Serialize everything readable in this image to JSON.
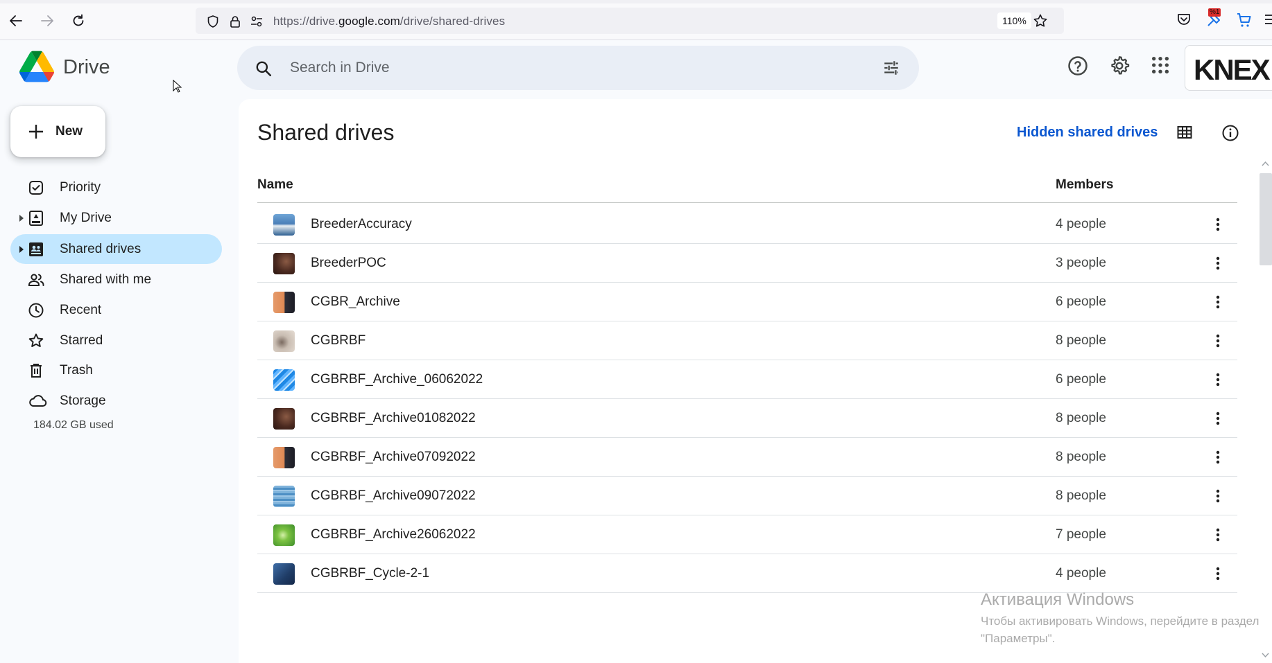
{
  "browser": {
    "url_prefix": "https://drive.",
    "url_host": "google.com",
    "url_path": "/drive/shared-drives",
    "zoom": "110%",
    "extension_badge": "%1"
  },
  "header": {
    "app_name": "Drive",
    "search_placeholder": "Search in Drive",
    "account_logo_text": "KNEX"
  },
  "sidebar": {
    "new_label": "New",
    "items": [
      {
        "label": "Priority",
        "icon": "priority-icon",
        "active": false,
        "has_caret": false
      },
      {
        "label": "My Drive",
        "icon": "my-drive-icon",
        "active": false,
        "has_caret": true
      },
      {
        "label": "Shared drives",
        "icon": "shared-drives-icon",
        "active": true,
        "has_caret": true
      },
      {
        "label": "Shared with me",
        "icon": "shared-with-me-icon",
        "active": false,
        "has_caret": false
      },
      {
        "label": "Recent",
        "icon": "clock-icon",
        "active": false,
        "has_caret": false
      },
      {
        "label": "Starred",
        "icon": "star-icon",
        "active": false,
        "has_caret": false
      },
      {
        "label": "Trash",
        "icon": "trash-icon",
        "active": false,
        "has_caret": false
      },
      {
        "label": "Storage",
        "icon": "cloud-icon",
        "active": false,
        "has_caret": false
      }
    ],
    "storage_used": "184.02 GB used"
  },
  "main": {
    "title": "Shared drives",
    "hidden_link": "Hidden shared drives",
    "columns": {
      "name": "Name",
      "members": "Members"
    },
    "rows": [
      {
        "name": "BreederAccuracy",
        "members": "4 people",
        "thumb": "thumb-lake"
      },
      {
        "name": "BreederPOC",
        "members": "3 people",
        "thumb": "thumb-leather"
      },
      {
        "name": "CGBR_Archive",
        "members": "6 people",
        "thumb": "thumb-orange"
      },
      {
        "name": "CGBRBF",
        "members": "8 people",
        "thumb": "thumb-beige"
      },
      {
        "name": "CGBRBF_Archive_06062022",
        "members": "6 people",
        "thumb": "thumb-blue-stripes"
      },
      {
        "name": "CGBRBF_Archive01082022",
        "members": "8 people",
        "thumb": "thumb-leather"
      },
      {
        "name": "CGBRBF_Archive07092022",
        "members": "8 people",
        "thumb": "thumb-orange"
      },
      {
        "name": "CGBRBF_Archive09072022",
        "members": "8 people",
        "thumb": "thumb-water"
      },
      {
        "name": "CGBRBF_Archive26062022",
        "members": "7 people",
        "thumb": "thumb-leaf"
      },
      {
        "name": "CGBRBF_Cycle-2-1",
        "members": "4 people",
        "thumb": "thumb-navy"
      }
    ]
  },
  "watermark": {
    "title": "Активация Windows",
    "line1": "Чтобы активировать Windows, перейдите в раздел",
    "line2": "\"Параметры\"."
  }
}
